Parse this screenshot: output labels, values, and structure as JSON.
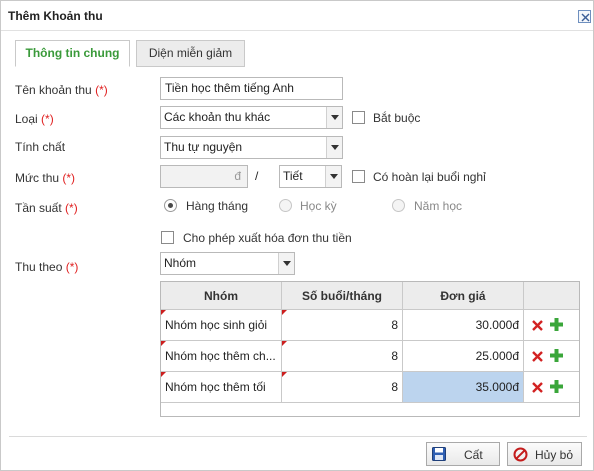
{
  "dialog": {
    "title": "Thêm Khoản thu"
  },
  "tabs": {
    "general": "Thông tin chung",
    "discount": "Diện miễn giảm"
  },
  "form": {
    "name_label": "Tên khoản thu",
    "name_value": "Tiền học thêm tiếng Anh",
    "type_label": "Loại",
    "type_value": "Các khoản thu khác",
    "mandatory_label": "Bắt buộc",
    "nature_label": "Tính chất",
    "nature_value": "Thu tự nguyện",
    "rate_label": "Mức thu",
    "rate_unit": "đ",
    "rate_sep": "/",
    "rate_per_value": "Tiết",
    "refund_label": "Có hoàn lại buổi nghỉ",
    "freq_label": "Tần suất",
    "freq_monthly": "Hàng tháng",
    "freq_term": "Học kỳ",
    "freq_year": "Năm học",
    "invoice_label": "Cho phép xuất hóa đơn thu tiền",
    "by_label": "Thu theo",
    "by_value": "Nhóm",
    "required_mark": "(*)"
  },
  "grid": {
    "headers": [
      "Nhóm",
      "Số buổi/tháng",
      "Đơn giá"
    ],
    "rows": [
      {
        "group": "Nhóm học sinh giỏi",
        "sessions": "8",
        "price": "30.000đ"
      },
      {
        "group": "Nhóm học thêm ch...",
        "sessions": "8",
        "price": "25.000đ"
      },
      {
        "group": "Nhóm học thêm tối",
        "sessions": "8",
        "price": "35.000đ"
      }
    ]
  },
  "buttons": {
    "save": "Cất",
    "cancel": "Hủy bỏ"
  },
  "colors": {
    "accent_green": "#3a9a3a",
    "required_red": "#e02020",
    "delete_red": "#d22222",
    "add_green": "#3aa63a",
    "selected_cell": "#bcd4ee"
  }
}
